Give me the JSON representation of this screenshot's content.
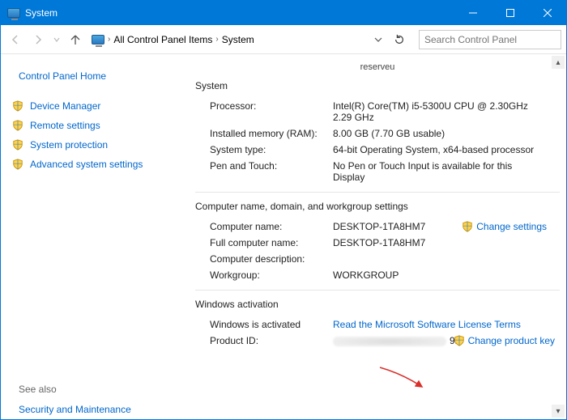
{
  "window": {
    "title": "System"
  },
  "breadcrumb": {
    "items": [
      "All Control Panel Items",
      "System"
    ]
  },
  "search": {
    "placeholder": "Search Control Panel"
  },
  "sidebar": {
    "home": "Control Panel Home",
    "items": [
      {
        "label": "Device Manager"
      },
      {
        "label": "Remote settings"
      },
      {
        "label": "System protection"
      },
      {
        "label": "Advanced system settings"
      }
    ],
    "see_also_heading": "See also",
    "see_also": [
      {
        "label": "Security and Maintenance"
      }
    ]
  },
  "content": {
    "truncated_top": "reserveu",
    "system_heading": "System",
    "system_rows": [
      {
        "label": "Processor:",
        "value": "Intel(R) Core(TM) i5-5300U CPU @ 2.30GHz 2.29 GHz"
      },
      {
        "label": "Installed memory (RAM):",
        "value": "8.00 GB (7.70 GB usable)"
      },
      {
        "label": "System type:",
        "value": "64-bit Operating System, x64-based processor"
      },
      {
        "label": "Pen and Touch:",
        "value": "No Pen or Touch Input is available for this Display"
      }
    ],
    "domain_heading": "Computer name, domain, and workgroup settings",
    "domain_rows": [
      {
        "label": "Computer name:",
        "value": "DESKTOP-1TA8HM7"
      },
      {
        "label": "Full computer name:",
        "value": "DESKTOP-1TA8HM7"
      },
      {
        "label": "Computer description:",
        "value": ""
      },
      {
        "label": "Workgroup:",
        "value": "WORKGROUP"
      }
    ],
    "change_settings": "Change settings",
    "activation_heading": "Windows activation",
    "activation_status": "Windows is activated",
    "license_link": "Read the Microsoft Software License Terms",
    "product_id_label": "Product ID:",
    "product_id_suffix": "91",
    "change_key": "Change product key"
  }
}
